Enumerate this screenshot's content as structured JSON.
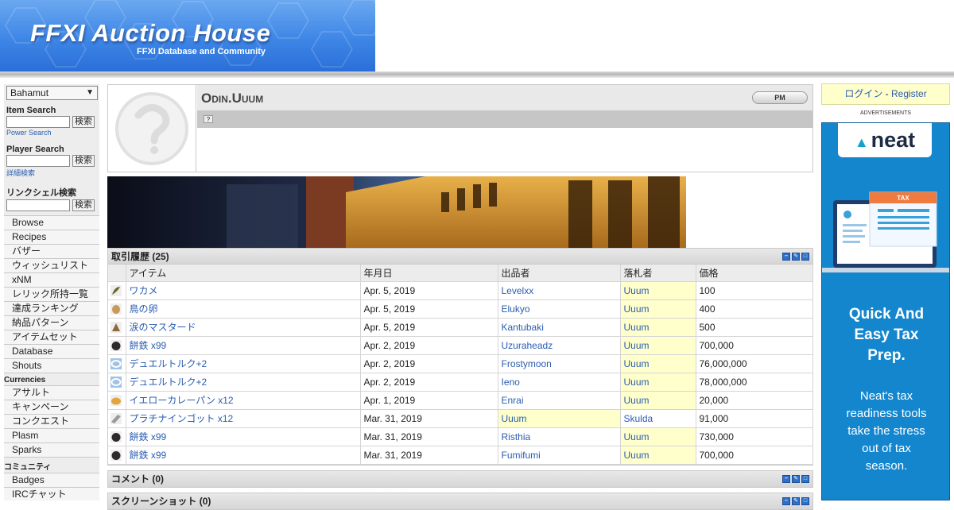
{
  "header": {
    "title": "FFXI Auction House",
    "subtitle": "FFXI Database and Community"
  },
  "sidebar": {
    "server": "Bahamut",
    "item_search_label": "Item Search",
    "search_button": "検索",
    "power_search": "Power Search",
    "player_search_label": "Player Search",
    "detail_search": "詳細検索",
    "linkshell_search_label": "リンクシェル検索",
    "nav": [
      {
        "label": "Browse"
      },
      {
        "label": "Recipes"
      },
      {
        "label": "バザー"
      },
      {
        "label": "ウィッシュリスト"
      },
      {
        "label": "xNM"
      },
      {
        "label": "レリック所持一覧"
      },
      {
        "label": "達成ランキング"
      },
      {
        "label": "納品パターン"
      },
      {
        "label": "アイテムセット"
      },
      {
        "label": "Database"
      },
      {
        "label": "Shouts"
      }
    ],
    "currencies_label": "Currencies",
    "currencies": [
      {
        "label": "アサルト"
      },
      {
        "label": "キャンペーン"
      },
      {
        "label": "コンクエスト"
      },
      {
        "label": "Plasm"
      },
      {
        "label": "Sparks"
      }
    ],
    "community_label": "コミュニティ",
    "community": [
      {
        "label": "Badges"
      },
      {
        "label": "IRCチャット"
      }
    ]
  },
  "profile": {
    "name": "Odin.Uuum",
    "pm_label": "PM",
    "help_mark": "?"
  },
  "history": {
    "title": "取引履歴 (25)",
    "columns": [
      "アイテム",
      "年月日",
      "出品者",
      "落札者",
      "価格"
    ],
    "rows": [
      {
        "icon": "kelp",
        "item": "ワカメ",
        "date": "Apr. 5, 2019",
        "seller": "Levelxx",
        "buyer": "Uuum",
        "price": "100",
        "hl": "buyer"
      },
      {
        "icon": "egg",
        "item": "鳥の卵",
        "date": "Apr. 5, 2019",
        "seller": "Elukyo",
        "buyer": "Uuum",
        "price": "400",
        "hl": "buyer"
      },
      {
        "icon": "mustard",
        "item": "涙のマスタード",
        "date": "Apr. 5, 2019",
        "seller": "Kantubaki",
        "buyer": "Uuum",
        "price": "500",
        "hl": "buyer"
      },
      {
        "icon": "ore",
        "item": "餅鉄 x99",
        "date": "Apr. 2, 2019",
        "seller": "Uzuraheadz",
        "buyer": "Uuum",
        "price": "700,000",
        "hl": "buyer"
      },
      {
        "icon": "torque",
        "item": "デュエルトルク+2",
        "date": "Apr. 2, 2019",
        "seller": "Frostymoon",
        "buyer": "Uuum",
        "price": "76,000,000",
        "hl": "buyer"
      },
      {
        "icon": "torque",
        "item": "デュエルトルク+2",
        "date": "Apr. 2, 2019",
        "seller": "Ieno",
        "buyer": "Uuum",
        "price": "78,000,000",
        "hl": "buyer"
      },
      {
        "icon": "bread",
        "item": "イエローカレーパン x12",
        "date": "Apr. 1, 2019",
        "seller": "Enrai",
        "buyer": "Uuum",
        "price": "20,000",
        "hl": "buyer"
      },
      {
        "icon": "ingot",
        "item": "プラチナインゴット x12",
        "date": "Mar. 31, 2019",
        "seller": "Uuum",
        "buyer": "Skulda",
        "price": "91,000",
        "hl": "seller"
      },
      {
        "icon": "ore",
        "item": "餅鉄 x99",
        "date": "Mar. 31, 2019",
        "seller": "Risthia",
        "buyer": "Uuum",
        "price": "730,000",
        "hl": "buyer"
      },
      {
        "icon": "ore",
        "item": "餅鉄 x99",
        "date": "Mar. 31, 2019",
        "seller": "Fumifumi",
        "buyer": "Uuum",
        "price": "700,000",
        "hl": "buyer"
      }
    ]
  },
  "comments": {
    "title": "コメント (0)"
  },
  "screenshots": {
    "title": "スクリーンショット (0)"
  },
  "login": {
    "login_label": "ログイン",
    "separator": " - ",
    "register_label": "Register"
  },
  "ads": {
    "label": "ADVERTISEMENTS",
    "brand": "neat",
    "tax_label": "TAX",
    "headline": "Quick And\nEasy Tax\nPrep.",
    "body": "Neat's tax\nreadiness tools\ntake the stress\nout of tax\nseason."
  }
}
